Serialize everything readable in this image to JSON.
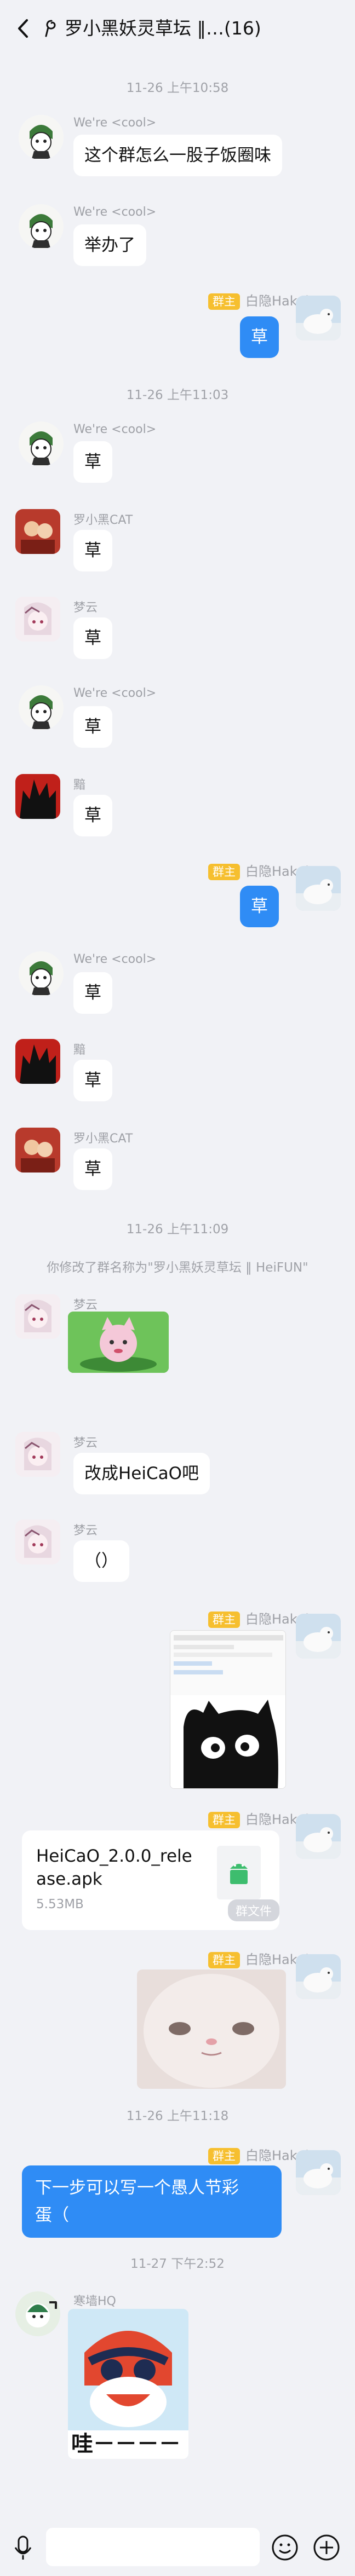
{
  "header": {
    "title": "罗小黑妖灵草坛 ‖…(16)"
  },
  "messages": {
    "t1": "11-26 上午10:58",
    "m1_name": "We're <cool>",
    "m1_text": "这个群怎么一股子饭圈味",
    "m2_name": "We're <cool>",
    "m2_text": "举办了",
    "me_role": "群主",
    "me_name": "白隐Hakuin",
    "m3_text": "草",
    "t2": "11-26 上午11:03",
    "m4_name": "We're <cool>",
    "m4_text": "草",
    "m5_name": "罗小黑CAT",
    "m5_text": "草",
    "m6_name": "梦云",
    "m6_text": "草",
    "m7_name": "We're <cool>",
    "m7_text": "草",
    "m8_name": "黯",
    "m8_text": "草",
    "m9_text": "草",
    "m10_name": "We're <cool>",
    "m10_text": "草",
    "m11_name": "黯",
    "m11_text": "草",
    "m12_name": "罗小黑CAT",
    "m12_text": "草",
    "t3": "11-26 上午11:09",
    "sys1": "你修改了群名称为\"罗小黑妖灵草坛 ‖ HeiFUN\"",
    "m13_name": "梦云",
    "m14_name": "梦云",
    "m14_text": "改成HeiCaO吧",
    "m15_name": "梦云",
    "m15_text": "（）",
    "file_name_1": "HeiCaO_2.0.0_rele",
    "file_name_2": "ase.apk",
    "file_size": "5.53MB",
    "file_tag": "群文件",
    "t4": "11-26 上午11:18",
    "m20_text_1": "下一步可以写一个愚人节彩",
    "m20_text_2": "蛋（",
    "t5": "11-27 下午2:52",
    "m21_name": "寒墙HQ",
    "m21_caption": "哇－－－－"
  },
  "colors": {
    "accent": "#2f8cf5",
    "role_badge": "#f6bf2f",
    "background": "#f1f2f6"
  }
}
